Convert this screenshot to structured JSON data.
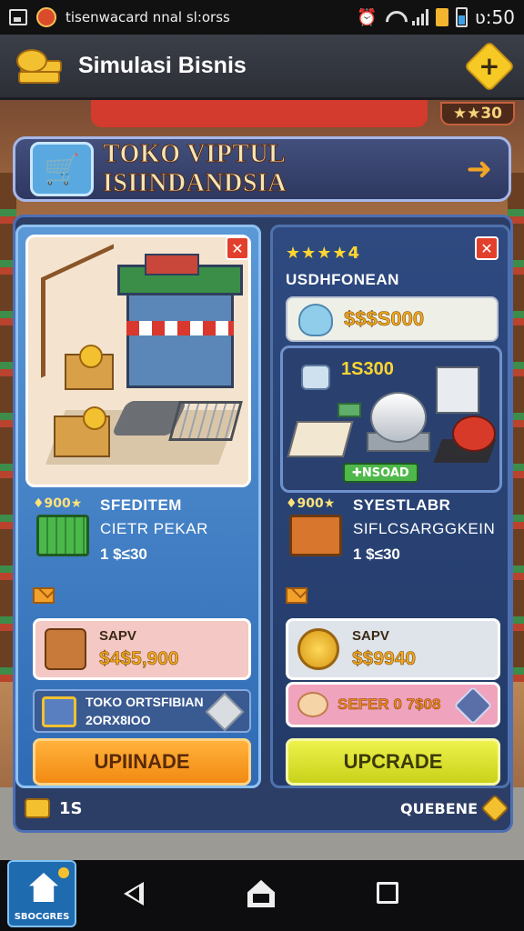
{
  "status_bar": {
    "notification_text": "tisenwacard nnal sl:orss",
    "time": "ʋ:50",
    "icons": [
      "image-icon",
      "app-notification-icon",
      "alarm-icon",
      "wifi-icon",
      "signal-icon",
      "sim-icon",
      "battery-icon"
    ]
  },
  "app_bar": {
    "title": "Simulasi Bisnis",
    "add_icon": "plus"
  },
  "rating": "★★30",
  "header": {
    "title": "TOKO VIPTUL ISIINDANDSIA",
    "arrow": "➜"
  },
  "left_card": {
    "item1": {
      "price_tag": "♦900★",
      "name": "SFEDITEM",
      "sub": "CIETR PEKAR",
      "cost": "1 $≤30"
    },
    "stat": {
      "label": "SAPV",
      "value": "$4$5,900"
    },
    "store_bar": {
      "line1": "TOKO ORTSFIBIAN",
      "line2": "2ORX8IOO"
    },
    "button": "UPIINADE"
  },
  "right_card": {
    "stars": "★★★★4",
    "title": "USDHFONEAN",
    "price": "$$$S000",
    "equipment_number": "1S300",
    "equipment_badge": "✚NSOAD",
    "item1": {
      "price_tag": "♦900★",
      "name": "SYESTLABR",
      "sub": "SIFLCSARGGKEIN",
      "cost": "1 $≤30"
    },
    "stat": {
      "label": "SAPV",
      "value": "$$9940"
    },
    "promo": "SEFER 0 7$08",
    "button": "UPCRADE"
  },
  "footer": {
    "left_value": "1S",
    "right_label": "QUEBENE"
  },
  "nav": {
    "home_tile_label": "SBOCGRES"
  },
  "colors": {
    "accent_yellow": "#f6c925",
    "panel_blue": "#2c3e66",
    "button_orange": "#f28a12",
    "button_yellow": "#c9d21a"
  }
}
